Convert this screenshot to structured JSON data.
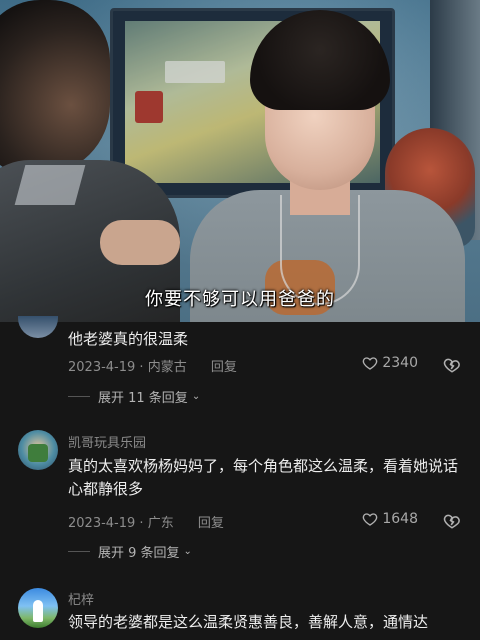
{
  "video": {
    "subtitle": "你要不够可以用爸爸的"
  },
  "comments": [
    {
      "author": "",
      "text": "他老婆真的很温柔",
      "date": "2023-4-19",
      "location": "内蒙古",
      "reply_label": "回复",
      "likes": "2340",
      "expand_label": "展开 11 条回复"
    },
    {
      "author": "凯哥玩具乐园",
      "text": "真的太喜欢杨杨妈妈了，每个角色都这么温柔，看着她说话心都静很多",
      "date": "2023-4-19",
      "location": "广东",
      "reply_label": "回复",
      "likes": "1648",
      "expand_label": "展开 9 条回复"
    },
    {
      "author": "杞梓",
      "text": "领导的老婆都是这么温柔贤惠善良，善解人意，通情达"
    }
  ],
  "colors": {
    "background": "#161616",
    "text_primary": "#ededed",
    "text_secondary": "#8d8d8d"
  }
}
